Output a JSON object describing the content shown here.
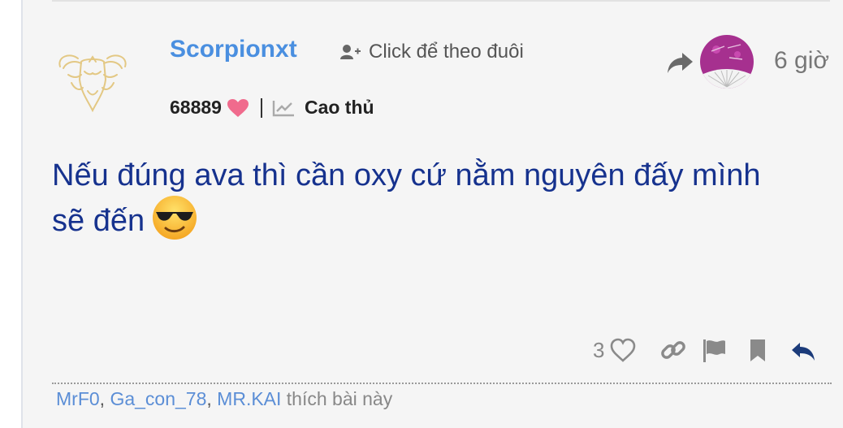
{
  "post": {
    "username": "Scorpionxt",
    "follow_text": "Click để theo đuôi",
    "time": "6 giờ",
    "reputation": "68889",
    "rank": "Cao thủ",
    "content_line1": "Nếu đúng ava thì cần oxy cứ nằm nguyên đấy mình",
    "content_line2": "sẽ đến"
  },
  "actions": {
    "like_count": "3"
  },
  "likes_bar": {
    "users": [
      "MrF0",
      "Ga_con_78",
      "MR.KAI"
    ],
    "suffix": "thích bài này"
  },
  "colors": {
    "username": "#4a8fe0",
    "content": "#16328e",
    "heart": "#f06b8d",
    "profile_bg": "#a6308f"
  },
  "icons": [
    "avatar-buffalo-icon",
    "follow-icon",
    "share-icon",
    "heart-icon",
    "rank-chart-icon",
    "sunglasses-emoji",
    "like-heart-icon",
    "link-icon",
    "flag-icon",
    "bookmark-icon",
    "reply-icon"
  ]
}
